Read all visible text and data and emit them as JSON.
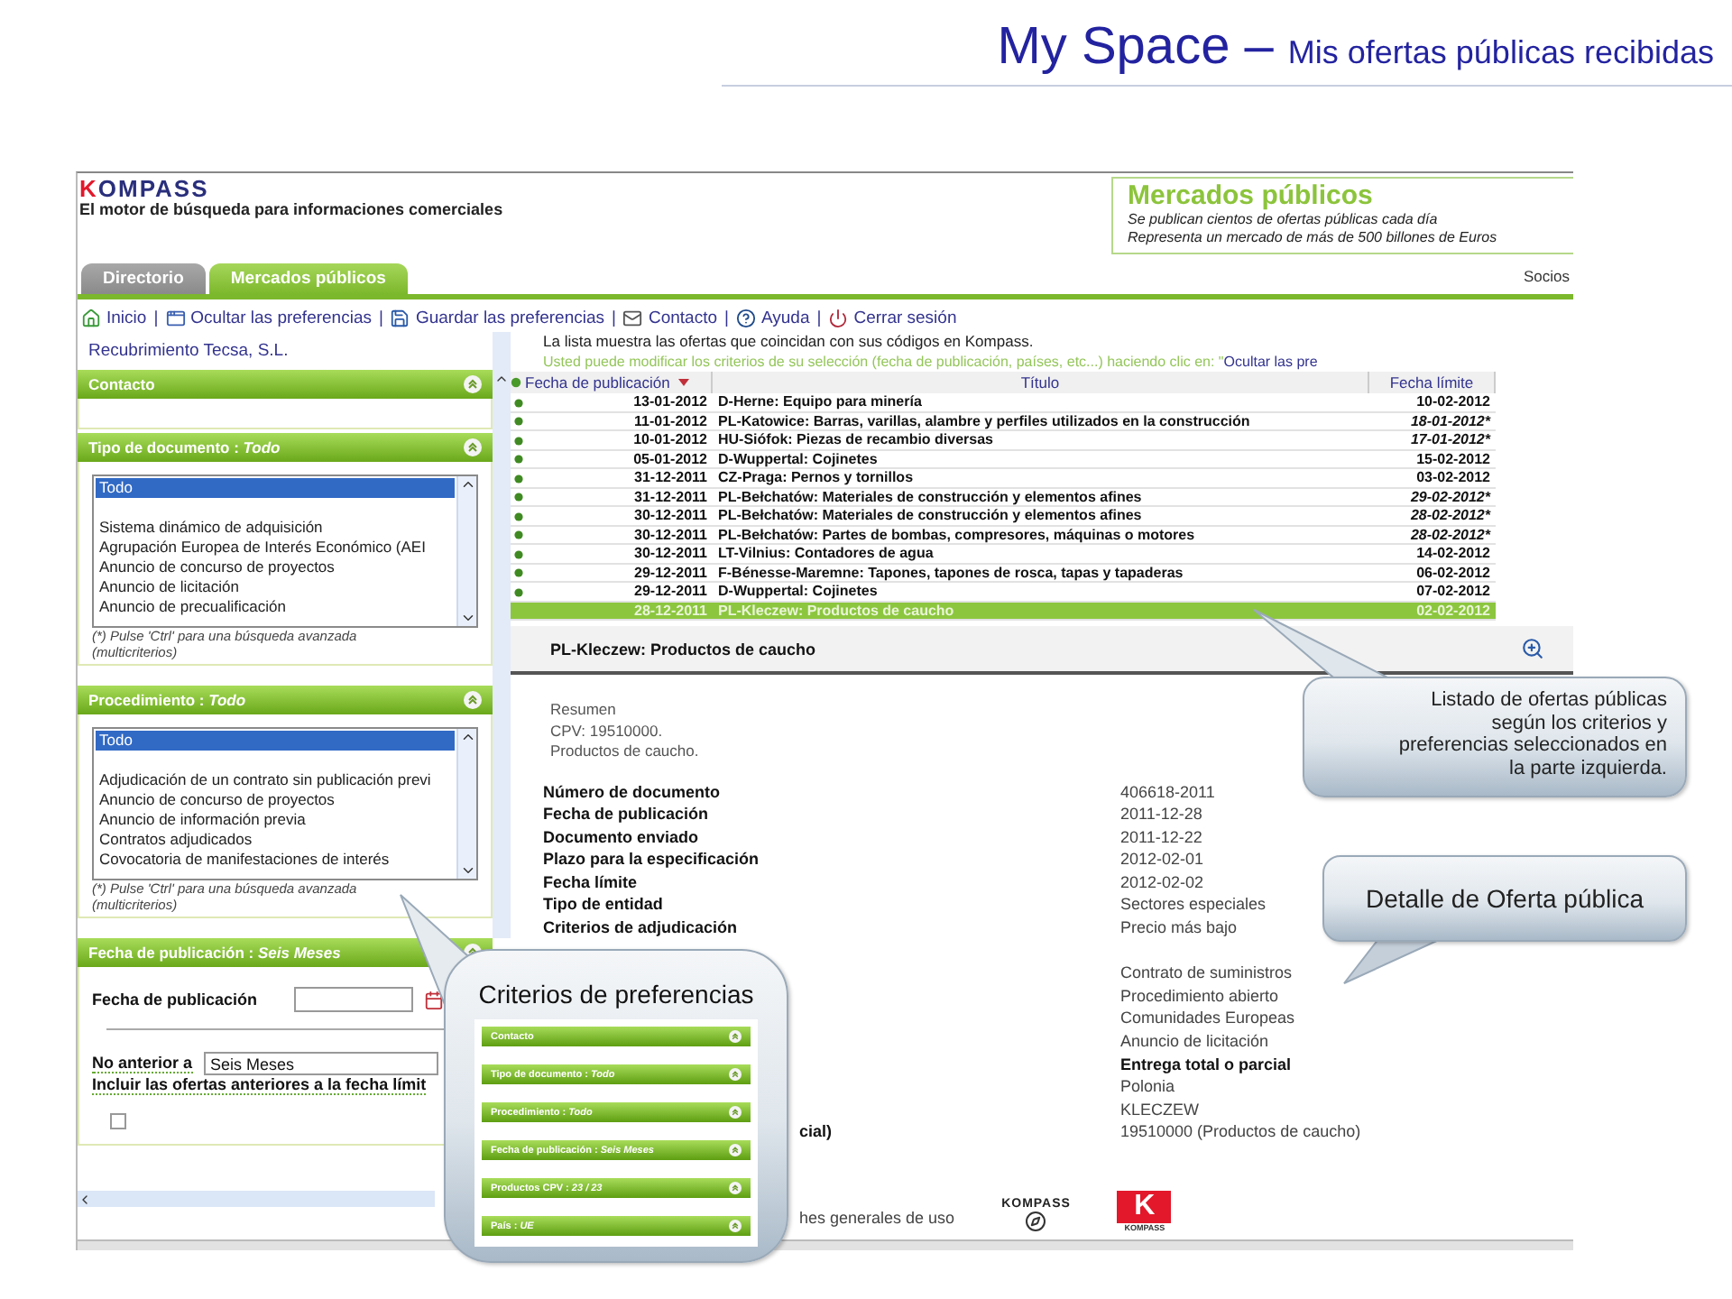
{
  "slide_title": {
    "main": "My Space –",
    "sub": "Mis ofertas públicas recibidas"
  },
  "header": {
    "logo": "KOMPASS",
    "tagline": "El motor de búsqueda para informaciones comerciales",
    "promo": {
      "title": "Mercados públicos",
      "lines": [
        "Se publican cientos de ofertas públicas cada día",
        "Representa un mercado de más de 500 billones de Euros"
      ]
    }
  },
  "tabs": [
    {
      "label": "Directorio",
      "selected": false
    },
    {
      "label": "Mercados públicos",
      "selected": true
    }
  ],
  "partners_link": "Socios",
  "toolbar": [
    {
      "kind": "link",
      "label": "Inicio"
    },
    {
      "kind": "separator",
      "label": "|"
    },
    {
      "kind": "link",
      "label": "Ocultar las preferencias"
    },
    {
      "kind": "separator",
      "label": "|"
    },
    {
      "kind": "link",
      "label": "Guardar las preferencias"
    },
    {
      "kind": "separator",
      "label": "|"
    },
    {
      "kind": "link",
      "label": "Contacto"
    },
    {
      "kind": "separator",
      "label": "|"
    },
    {
      "kind": "link",
      "label": "Ayuda"
    },
    {
      "kind": "separator",
      "label": "|"
    },
    {
      "kind": "link",
      "label": "Cerrar sesión"
    }
  ],
  "company": "Recubrimiento Tecsa, S.L.",
  "panels": [
    {
      "kind": "plain",
      "title": "Contacto"
    },
    {
      "kind": "listbox",
      "title": "Tipo de documento : *Todo*",
      "options": [
        {
          "label": "Todo",
          "selected": true
        },
        {
          "label": "Sistema dinámico de adquisición",
          "selected": false
        },
        {
          "label": "Agrupación Europea de Interés Económico (AEI",
          "selected": false
        },
        {
          "label": "Anuncio de concurso de proyectos",
          "selected": false
        },
        {
          "label": "Anuncio de licitación",
          "selected": false
        },
        {
          "label": "Anuncio de precualificación",
          "selected": false
        }
      ],
      "note": "(*) Pulse 'Ctrl' para una búsqueda avanzada (multicriterios)"
    },
    {
      "kind": "listbox",
      "title": "Procedimiento : *Todo*",
      "options": [
        {
          "label": "Todo",
          "selected": true
        },
        {
          "label": "Adjudicación de un contrato sin publicación previ",
          "selected": false
        },
        {
          "label": "Anuncio de concurso de proyectos",
          "selected": false
        },
        {
          "label": "Anuncio de información previa",
          "selected": false
        },
        {
          "label": "Contratos adjudicados",
          "selected": false
        },
        {
          "label": "Covocatoria de manifestaciones de interés",
          "selected": false
        }
      ],
      "note": "(*) Pulse 'Ctrl' para una búsqueda avanzada (multicriterios)"
    },
    {
      "kind": "date",
      "title": "Fecha de publicación : *Seis Meses*",
      "date_label": "Fecha de publicación",
      "period_label": "No anterior a",
      "period_value": "Seis Meses",
      "include_label": "Incluir las ofertas anteriores a la fecha límit",
      "include_checked": false
    }
  ],
  "info": {
    "line": "La lista muestra las ofertas que coincidan con sus códigos en Kompass.",
    "hint": "Usted puede modificar los criterios de su selección (fecha de publicación, países, etc...) haciendo clic en: \"",
    "hint_link": "Ocultar las pre"
  },
  "table": {
    "columns": [
      "Fecha de publicación",
      "Título",
      "Fecha límite"
    ],
    "rows": [
      {
        "date": "13-01-2012",
        "title": "D-Herne: Equipo para minería",
        "limit": "10-02-2012",
        "estimated": false,
        "selected": false
      },
      {
        "date": "11-01-2012",
        "title": "PL-Katowice: Barras, varillas, alambre y perfiles utilizados en la construcción",
        "limit": "18-01-2012*",
        "estimated": true,
        "selected": false
      },
      {
        "date": "10-01-2012",
        "title": "HU-Siófok: Piezas de recambio diversas",
        "limit": "17-01-2012*",
        "estimated": true,
        "selected": false
      },
      {
        "date": "05-01-2012",
        "title": "D-Wuppertal: Cojinetes",
        "limit": "15-02-2012",
        "estimated": false,
        "selected": false
      },
      {
        "date": "31-12-2011",
        "title": "CZ-Praga: Pernos y tornillos",
        "limit": "03-02-2012",
        "estimated": false,
        "selected": false
      },
      {
        "date": "31-12-2011",
        "title": "PL-Bełchatów: Materiales de construcción y elementos afines",
        "limit": "29-02-2012*",
        "estimated": true,
        "selected": false
      },
      {
        "date": "30-12-2011",
        "title": "PL-Bełchatów: Materiales de construcción y elementos afines",
        "limit": "28-02-2012*",
        "estimated": true,
        "selected": false
      },
      {
        "date": "30-12-2011",
        "title": "PL-Bełchatów: Partes de bombas, compresores, máquinas o motores",
        "limit": "28-02-2012*",
        "estimated": true,
        "selected": false
      },
      {
        "date": "30-12-2011",
        "title": "LT-Vilnius: Contadores de agua",
        "limit": "14-02-2012",
        "estimated": false,
        "selected": false
      },
      {
        "date": "29-12-2011",
        "title": "F-Bénesse-Maremne: Tapones, tapones de rosca, tapas y tapaderas",
        "limit": "06-02-2012",
        "estimated": false,
        "selected": false
      },
      {
        "date": "29-12-2011",
        "title": "D-Wuppertal: Cojinetes",
        "limit": "07-02-2012",
        "estimated": false,
        "selected": false
      },
      {
        "date": "28-12-2011",
        "title": "PL-Kleczew: Productos de caucho",
        "limit": "02-02-2012",
        "estimated": false,
        "selected": true
      }
    ]
  },
  "detail": {
    "title": "PL-Kleczew: Productos de caucho",
    "summary": [
      "Resumen",
      "CPV: 19510000.",
      "Productos de caucho."
    ],
    "rows": [
      {
        "kind": "pair",
        "label": "Número de documento",
        "value": "406618-2011"
      },
      {
        "kind": "pair",
        "label": "Fecha de publicación",
        "value": "2011-12-28"
      },
      {
        "kind": "pair",
        "label": "Documento enviado",
        "value": "2011-12-22"
      },
      {
        "kind": "pair",
        "label": "Plazo para la especificación",
        "value": "2012-02-01"
      },
      {
        "kind": "pair",
        "label": "Fecha límite",
        "value": "2012-02-02"
      },
      {
        "kind": "pair",
        "label": "Tipo de entidad",
        "value": "Sectores especiales"
      },
      {
        "kind": "pair",
        "label": "Criterios de adjudicación",
        "value": "Precio más bajo"
      },
      {
        "kind": "blank"
      },
      {
        "kind": "value",
        "value": "Contrato de suministros"
      },
      {
        "kind": "value",
        "value": "Procedimiento abierto"
      },
      {
        "kind": "value",
        "value": "Comunidades Europeas"
      },
      {
        "kind": "value",
        "value": "Anuncio de licitación"
      },
      {
        "kind": "heading",
        "value": "Entrega total o parcial"
      },
      {
        "kind": "value",
        "value": "Polonia"
      },
      {
        "kind": "value",
        "value": "KLECZEW"
      },
      {
        "kind": "clipped",
        "label": "cial)",
        "value": "19510000 (Productos de caucho)"
      }
    ]
  },
  "footer": {
    "link": "hes generales de uso",
    "wordmark": "KOMPASS",
    "badge": {
      "letter": "K",
      "caption": "KOMPASS"
    }
  },
  "callouts": [
    {
      "kind": "list",
      "lines": [
        "Listado de ofertas públicas",
        "según los criterios y",
        "preferencias seleccionados en",
        "la parte izquierda."
      ]
    },
    {
      "kind": "detail",
      "lines": [
        "Detalle de Oferta pública"
      ]
    },
    {
      "kind": "criteria",
      "title": "Criterios de preferencias",
      "items": [
        "Contacto",
        "Tipo de documento : *Todo*",
        "Procedimiento : *Todo*",
        "Fecha de publicación : *Seis Meses*",
        "Productos CPV : *23 / 23*",
        "País : *UE*"
      ]
    }
  ]
}
